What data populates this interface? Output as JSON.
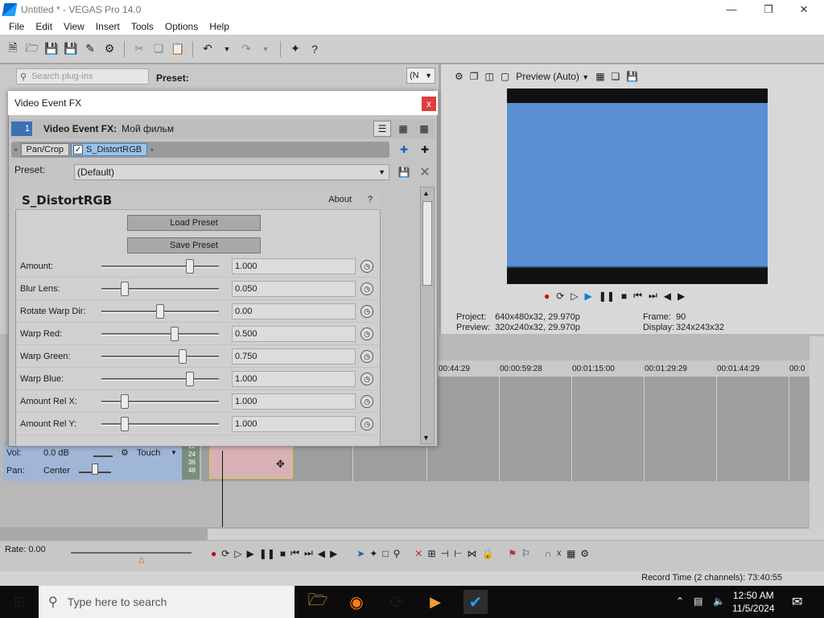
{
  "window": {
    "title": "Untitled * - VEGAS Pro 14.0"
  },
  "menu": [
    "File",
    "Edit",
    "View",
    "Insert",
    "Tools",
    "Options",
    "Help"
  ],
  "plugin_panel": {
    "search_placeholder": "Search plug-ins",
    "preset_label": "Preset:",
    "dropdown_value": "(N"
  },
  "preview": {
    "mode": "Preview (Auto)",
    "project_label": "Project:",
    "project_value": "640x480x32, 29.970p",
    "preview_label": "Preview:",
    "preview_value": "320x240x32, 29.970p",
    "frame_label": "Frame:",
    "frame_value": "90",
    "display_label": "Display:",
    "display_value": "324x243x32"
  },
  "timeline": {
    "ruler": [
      "00:44:29",
      "00:00:59:28",
      "00:01:15:00",
      "00:01:29:29",
      "00:01:44:29",
      "00:0"
    ],
    "track": {
      "vol_label": "Vol:",
      "vol_value": "0.0 dB",
      "pan_label": "Pan:",
      "pan_value": "Center",
      "mode": "Touch",
      "meter": [
        "12",
        "24",
        "36",
        "48"
      ]
    },
    "rate": "Rate: 0.00"
  },
  "status": {
    "record_time": "Record Time (2 channels): 73:40:55"
  },
  "dialog": {
    "title": "Video Event FX",
    "close": "x",
    "fx_num": "1",
    "fx_label": "Video Event FX:",
    "fx_value": "Мой фильм",
    "chain": [
      "Pan/Crop",
      "S_DistortRGB"
    ],
    "preset_label": "Preset:",
    "preset_value": "(Default)",
    "plugin_name": "S_DistortRGB",
    "about": "About",
    "help": "?",
    "load_preset": "Load Preset",
    "save_preset": "Save Preset",
    "params": [
      {
        "name": "Amount:",
        "value": "1.000",
        "level": 0.75
      },
      {
        "name": "Blur Lens:",
        "value": "0.050",
        "level": 0.2
      },
      {
        "name": "Rotate Warp Dir:",
        "value": "0.00",
        "level": 0.5
      },
      {
        "name": "Warp Red:",
        "value": "0.500",
        "level": 0.62
      },
      {
        "name": "Warp Green:",
        "value": "0.750",
        "level": 0.69
      },
      {
        "name": "Warp Blue:",
        "value": "1.000",
        "level": 0.75
      },
      {
        "name": "Amount Rel X:",
        "value": "1.000",
        "level": 0.2
      },
      {
        "name": "Amount Rel Y:",
        "value": "1.000",
        "level": 0.2
      }
    ]
  },
  "taskbar": {
    "search_placeholder": "Type here to search",
    "time": "12:50 AM",
    "date": "11/5/2024"
  }
}
